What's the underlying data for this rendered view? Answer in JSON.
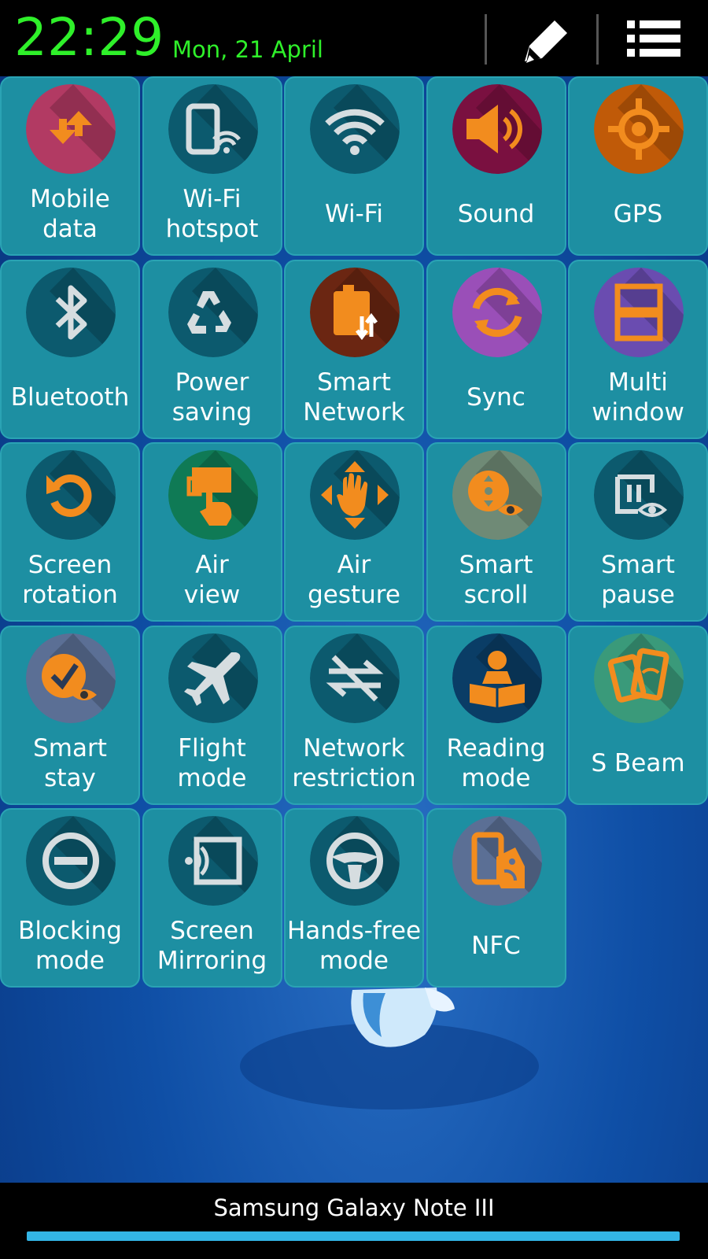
{
  "status": {
    "time": "22:29",
    "date": "Mon, 21 April"
  },
  "header": {
    "edit_icon": "pencil-icon",
    "menu_icon": "list-icon"
  },
  "tiles": [
    {
      "label": "Mobile\ndata",
      "icon": "mobile-data-icon",
      "color": "#b23a63"
    },
    {
      "label": "Wi-Fi\nhotspot",
      "icon": "wifi-hotspot-icon",
      "color": "#0c5a6e"
    },
    {
      "label": "Wi-Fi",
      "icon": "wifi-icon",
      "color": "#0c5a6e"
    },
    {
      "label": "Sound",
      "icon": "sound-icon",
      "color": "#7a1040"
    },
    {
      "label": "GPS",
      "icon": "gps-icon",
      "color": "#c05a08"
    },
    {
      "label": "Bluetooth",
      "icon": "bluetooth-icon",
      "color": "#0c5a6e"
    },
    {
      "label": "Power\nsaving",
      "icon": "power-saving-icon",
      "color": "#0c5a6e"
    },
    {
      "label": "Smart\nNetwork",
      "icon": "smart-network-icon",
      "color": "#6b2612"
    },
    {
      "label": "Sync",
      "icon": "sync-icon",
      "color": "#9a4fb8"
    },
    {
      "label": "Multi\nwindow",
      "icon": "multi-window-icon",
      "color": "#6a4cb0"
    },
    {
      "label": "Screen\nrotation",
      "icon": "screen-rotation-icon",
      "color": "#0c5a6e"
    },
    {
      "label": "Air\nview",
      "icon": "air-view-icon",
      "color": "#0f7a55"
    },
    {
      "label": "Air\ngesture",
      "icon": "air-gesture-icon",
      "color": "#0c5a6e"
    },
    {
      "label": "Smart\nscroll",
      "icon": "smart-scroll-icon",
      "color": "#6f8a76"
    },
    {
      "label": "Smart\npause",
      "icon": "smart-pause-icon",
      "color": "#0c5a6e"
    },
    {
      "label": "Smart\nstay",
      "icon": "smart-stay-icon",
      "color": "#5b6f95"
    },
    {
      "label": "Flight\nmode",
      "icon": "airplane-icon",
      "color": "#0c5a6e"
    },
    {
      "label": "Network\nrestriction",
      "icon": "network-restriction-icon",
      "color": "#0c5a6e"
    },
    {
      "label": "Reading\nmode",
      "icon": "reading-mode-icon",
      "color": "#0a3d66"
    },
    {
      "label": "S Beam",
      "icon": "s-beam-icon",
      "color": "#3a9a7a"
    },
    {
      "label": "Blocking\nmode",
      "icon": "blocking-mode-icon",
      "color": "#0c5a6e"
    },
    {
      "label": "Screen\nMirroring",
      "icon": "screen-mirroring-icon",
      "color": "#0c5a6e"
    },
    {
      "label": "Hands-free\nmode",
      "icon": "steering-wheel-icon",
      "color": "#0c5a6e"
    },
    {
      "label": "NFC",
      "icon": "nfc-icon",
      "color": "#5b6f95"
    }
  ],
  "footer": {
    "device_name": "Samsung Galaxy Note III",
    "progress": 1.0
  }
}
